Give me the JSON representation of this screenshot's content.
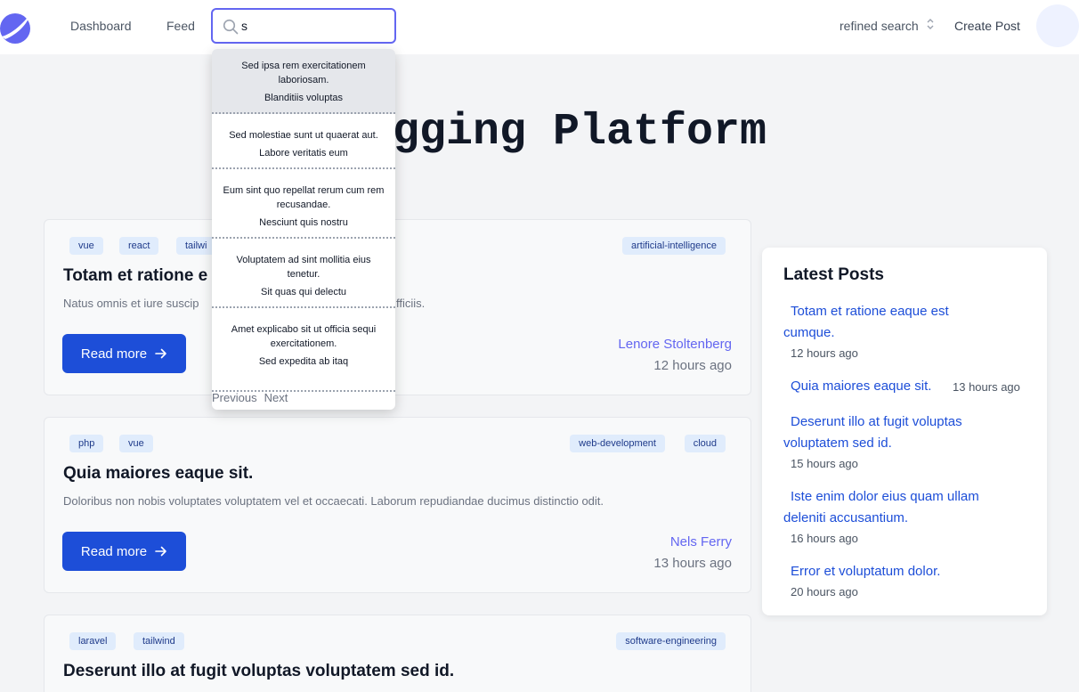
{
  "nav": {
    "dashboard": "Dashboard",
    "feed": "Feed",
    "search_value": "s",
    "refine_label": "refined search",
    "create_post": "Create Post"
  },
  "hero": {
    "title": "Blogging Platform"
  },
  "posts": [
    {
      "tags_left": [
        "vue",
        "react",
        "tailwi"
      ],
      "tags_right": [
        "artificial-intelligence"
      ],
      "title": "Totam et ratione e",
      "excerpt": "Natus omnis et iure suscip",
      "excerpt_tail": "fficiis.",
      "read_more": "Read more",
      "author": "Lenore Stoltenberg",
      "time": "12 hours ago"
    },
    {
      "tags_left": [
        "php",
        "vue"
      ],
      "tags_right": [
        "web-development",
        "cloud"
      ],
      "title": "Quia maiores eaque sit.",
      "excerpt": "Doloribus non nobis voluptates voluptatem vel et occaecati. Laborum repudiandae ducimus distinctio odit.",
      "read_more": "Read more",
      "author": "Nels Ferry",
      "time": "13 hours ago"
    },
    {
      "tags_left": [
        "laravel",
        "tailwind"
      ],
      "tags_right": [
        "software-engineering"
      ],
      "title": "Deserunt illo at fugit voluptas voluptatem sed id."
    }
  ],
  "sidebar": {
    "title": "Latest Posts",
    "items": [
      {
        "line1": "Totam et ratione eaque est",
        "line2": "cumque.",
        "time": "12 hours ago"
      },
      {
        "line1": "Quia maiores eaque sit.",
        "time": "13 hours ago"
      },
      {
        "line1": "Deserunt illo at fugit voluptas",
        "line2": "voluptatem sed id.",
        "time": "15 hours ago"
      },
      {
        "line1": "Iste enim dolor eius quam ullam",
        "line2": "deleniti accusantium.",
        "time": "16 hours ago"
      },
      {
        "line1": "Error et voluptatum dolor.",
        "time": "20 hours ago"
      }
    ]
  },
  "dropdown": {
    "results": [
      {
        "title": "Sed ipsa rem exercitationem laboriosam.",
        "author": "Blanditiis voluptas"
      },
      {
        "title": "Sed molestiae sunt ut quaerat aut.",
        "author": "Labore veritatis eum"
      },
      {
        "title": "Eum sint quo repellat rerum cum rem recusandae.",
        "author": "Nesciunt quis nostru"
      },
      {
        "title": "Voluptatem ad sint mollitia eius tenetur.",
        "author": "Sit quas qui delectu"
      },
      {
        "title": "Amet explicabo sit ut officia sequi exercitationem.",
        "author": "Sed expedita ab itaq"
      }
    ],
    "previous": "Previous",
    "next": "Next"
  },
  "colors": {
    "accent": "#6366f1",
    "primary": "#1d4ed8",
    "tag_bg": "#e0ecfc"
  },
  "icons": [
    "logo-icon",
    "search-icon",
    "chevron-updown-icon",
    "arrow-right-icon"
  ]
}
